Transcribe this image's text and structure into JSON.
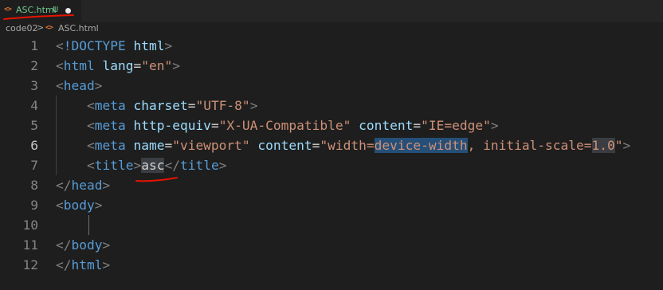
{
  "tab": {
    "filename": "ASC.html",
    "git_status": "U",
    "icon": "html-file-icon"
  },
  "breadcrumb": {
    "folder": "code02",
    "separator": ">",
    "file": "ASC.html"
  },
  "editor": {
    "lines": [
      {
        "n": "1",
        "tokens": [
          {
            "c": "t-punct",
            "t": "<"
          },
          {
            "c": "t-tag",
            "t": "!DOCTYPE"
          },
          {
            "c": "t-text",
            "t": " "
          },
          {
            "c": "t-attr",
            "t": "html"
          },
          {
            "c": "t-punct",
            "t": ">"
          }
        ]
      },
      {
        "n": "2",
        "tokens": [
          {
            "c": "t-punct",
            "t": "<"
          },
          {
            "c": "t-tag",
            "t": "html"
          },
          {
            "c": "t-text",
            "t": " "
          },
          {
            "c": "t-attr",
            "t": "lang"
          },
          {
            "c": "t-eq",
            "t": "="
          },
          {
            "c": "t-str",
            "t": "\"en\""
          },
          {
            "c": "t-punct",
            "t": ">"
          }
        ]
      },
      {
        "n": "3",
        "tokens": [
          {
            "c": "t-punct",
            "t": "<"
          },
          {
            "c": "t-tag",
            "t": "head"
          },
          {
            "c": "t-punct",
            "t": ">"
          }
        ]
      },
      {
        "n": "4",
        "tokens": [
          {
            "c": "t-text",
            "t": "    "
          },
          {
            "c": "t-punct",
            "t": "<"
          },
          {
            "c": "t-tag",
            "t": "meta"
          },
          {
            "c": "t-text",
            "t": " "
          },
          {
            "c": "t-attr",
            "t": "charset"
          },
          {
            "c": "t-eq",
            "t": "="
          },
          {
            "c": "t-str",
            "t": "\"UTF-8\""
          },
          {
            "c": "t-punct",
            "t": ">"
          }
        ]
      },
      {
        "n": "5",
        "tokens": [
          {
            "c": "t-text",
            "t": "    "
          },
          {
            "c": "t-punct",
            "t": "<"
          },
          {
            "c": "t-tag",
            "t": "meta"
          },
          {
            "c": "t-text",
            "t": " "
          },
          {
            "c": "t-attr",
            "t": "http-equiv"
          },
          {
            "c": "t-eq",
            "t": "="
          },
          {
            "c": "t-str",
            "t": "\"X-UA-Compatible\""
          },
          {
            "c": "t-text",
            "t": " "
          },
          {
            "c": "t-attr",
            "t": "content"
          },
          {
            "c": "t-eq",
            "t": "="
          },
          {
            "c": "t-str",
            "t": "\"IE=edge\""
          },
          {
            "c": "t-punct",
            "t": ">"
          }
        ]
      },
      {
        "n": "6",
        "active": true,
        "tokens": [
          {
            "c": "t-text",
            "t": "    "
          },
          {
            "c": "t-punct",
            "t": "<"
          },
          {
            "c": "t-tag",
            "t": "meta"
          },
          {
            "c": "t-text",
            "t": " "
          },
          {
            "c": "t-attr",
            "t": "name"
          },
          {
            "c": "t-eq",
            "t": "="
          },
          {
            "c": "t-str",
            "t": "\"viewport\""
          },
          {
            "c": "t-text",
            "t": " "
          },
          {
            "c": "t-attr",
            "t": "content"
          },
          {
            "c": "t-eq",
            "t": "="
          },
          {
            "c": "t-str",
            "t": "\"width="
          },
          {
            "c": "t-str sel",
            "t": "device-width"
          },
          {
            "c": "t-str",
            "t": ", initial-scale="
          },
          {
            "c": "t-str hl",
            "t": "1.0"
          },
          {
            "c": "t-str",
            "t": "\""
          },
          {
            "c": "t-punct",
            "t": ">"
          }
        ]
      },
      {
        "n": "7",
        "tokens": [
          {
            "c": "t-text",
            "t": "    "
          },
          {
            "c": "t-punct",
            "t": "<"
          },
          {
            "c": "t-tag",
            "t": "title"
          },
          {
            "c": "t-punct",
            "t": ">"
          },
          {
            "c": "t-text hl",
            "t": "asc"
          },
          {
            "c": "t-punct",
            "t": "</"
          },
          {
            "c": "t-tag",
            "t": "title"
          },
          {
            "c": "t-punct",
            "t": ">"
          }
        ]
      },
      {
        "n": "8",
        "tokens": [
          {
            "c": "t-punct",
            "t": "</"
          },
          {
            "c": "t-tag",
            "t": "head"
          },
          {
            "c": "t-punct",
            "t": ">"
          }
        ]
      },
      {
        "n": "9",
        "tokens": [
          {
            "c": "t-punct",
            "t": "<"
          },
          {
            "c": "t-tag",
            "t": "body"
          },
          {
            "c": "t-punct",
            "t": ">"
          }
        ]
      },
      {
        "n": "10",
        "tokens": []
      },
      {
        "n": "11",
        "tokens": [
          {
            "c": "t-punct",
            "t": "</"
          },
          {
            "c": "t-tag",
            "t": "body"
          },
          {
            "c": "t-punct",
            "t": ">"
          }
        ]
      },
      {
        "n": "12",
        "tokens": [
          {
            "c": "t-punct",
            "t": "</"
          },
          {
            "c": "t-tag",
            "t": "html"
          },
          {
            "c": "t-punct",
            "t": ">"
          }
        ]
      }
    ]
  },
  "colors": {
    "editor_bg": "#1e1e1e",
    "tag": "#569cd6",
    "attribute": "#9cdcfe",
    "string": "#ce9178",
    "punctuation": "#808080",
    "untracked_file": "#73c991",
    "selection": "#264f78",
    "annotation": "#e51400"
  }
}
